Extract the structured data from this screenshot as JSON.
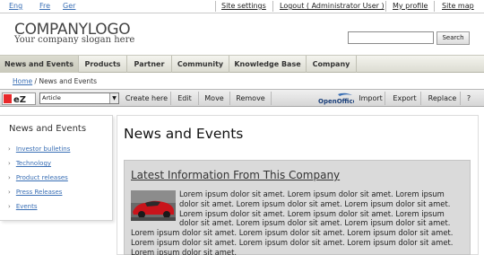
{
  "languages": [
    "Eng",
    "Fre",
    "Ger"
  ],
  "top_links": [
    "Site settings",
    "Logout ( Administrator User )",
    "My profile",
    "Site map"
  ],
  "logo": {
    "name": "COMPANYLOGO",
    "slogan": "Your company slogan here"
  },
  "search": {
    "value": "",
    "button": "Search"
  },
  "nav": [
    "News and Events",
    "Products",
    "Partner",
    "Community",
    "Knowledge Base",
    "Company"
  ],
  "breadcrumb": {
    "home": "Home",
    "separator": " / ",
    "current": "News and Events"
  },
  "ez_toolbar": {
    "class_select": "Article",
    "buttons": [
      "Create here",
      "Edit",
      "Move",
      "Remove"
    ],
    "right_buttons": [
      "Import",
      "Export",
      "Replace",
      "?"
    ],
    "openoffice_label": "OpenOffice"
  },
  "sidebar": {
    "title": "News and Events",
    "items": [
      "Investor bulletins",
      "Technology",
      "Product releases",
      "Press Releases",
      "Events"
    ]
  },
  "main": {
    "title": "News and Events",
    "info_title": "Latest Information From This Company",
    "paragraph": "Lorem ipsum dolor sit amet. Lorem ipsum dolor sit amet. Lorem ipsum dolor sit amet. Lorem ipsum dolor sit amet. Lorem ipsum dolor sit amet. Lorem ipsum dolor sit amet. Lorem ipsum dolor sit amet. Lorem ipsum dolor sit amet. Lorem ipsum dolor sit amet. Lorem ipsum dolor sit amet. Lorem ipsum dolor sit amet. Lorem ipsum dolor sit amet. Lorem ipsum dolor sit amet. Lorem ipsum dolor sit amet. Lorem ipsum dolor sit amet. Lorem ipsum dolor sit amet. Lorem ipsum dolor sit amet."
  },
  "colors": {
    "link": "#3a6fb5",
    "nav_bg": "#e6e6dc",
    "info_box": "#dadada"
  }
}
